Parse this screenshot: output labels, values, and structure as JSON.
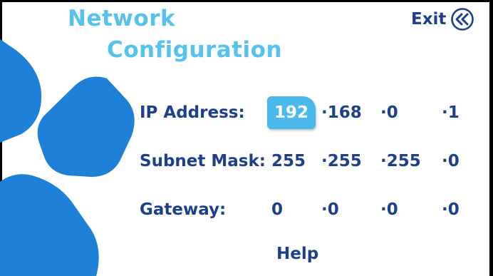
{
  "screen": {
    "title_line1": "Network",
    "title_line2": "Configuration",
    "exit_label": "Exit"
  },
  "colors": {
    "title": "#56c3ee",
    "text": "#1e3f8a",
    "highlight": "#4cb9ec",
    "decor": "#1e80d6"
  },
  "fields": {
    "ip": {
      "label": "IP Address:",
      "octets": [
        "192",
        "·168",
        "·0",
        "·1"
      ],
      "selected_octet": 1
    },
    "subnet": {
      "label": "Subnet Mask:",
      "octets": [
        "255",
        "·255",
        "·255",
        "·0"
      ]
    },
    "gateway": {
      "label": "Gateway:",
      "octets": [
        "0",
        "·0",
        "·0",
        "·0"
      ]
    }
  },
  "footer": {
    "help_label": "Help"
  },
  "icons": {
    "exit": "double-chevron-left-icon"
  }
}
